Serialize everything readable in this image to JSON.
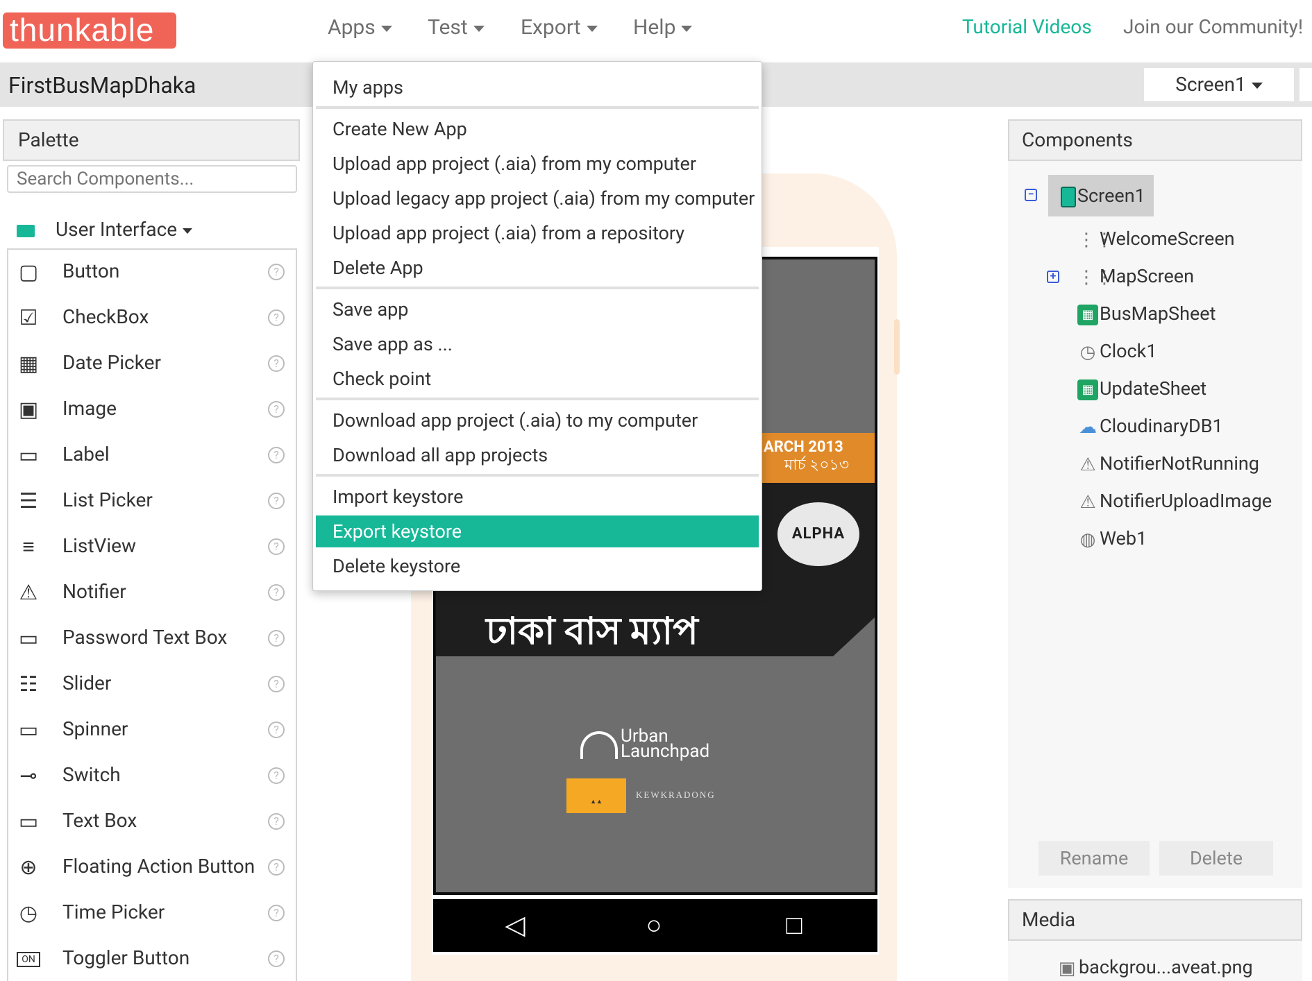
{
  "brand": {
    "logo": "thunkable"
  },
  "nav": {
    "items": [
      "Apps",
      "Test",
      "Export",
      "Help"
    ],
    "tutorial": "Tutorial Videos",
    "community": "Join our Community!"
  },
  "project": {
    "name": "FirstBusMapDhaka",
    "screen": "Screen1"
  },
  "palette": {
    "title": "Palette",
    "search_placeholder": "Search Components...",
    "category": "User Interface",
    "items": [
      {
        "label": "Button",
        "icon": "button-icon"
      },
      {
        "label": "CheckBox",
        "icon": "checkbox-icon"
      },
      {
        "label": "Date Picker",
        "icon": "calendar-icon"
      },
      {
        "label": "Image",
        "icon": "image-icon"
      },
      {
        "label": "Label",
        "icon": "label-icon"
      },
      {
        "label": "List Picker",
        "icon": "list-picker-icon"
      },
      {
        "label": "ListView",
        "icon": "list-icon"
      },
      {
        "label": "Notifier",
        "icon": "warning-icon"
      },
      {
        "label": "Password Text Box",
        "icon": "password-icon"
      },
      {
        "label": "Slider",
        "icon": "slider-icon"
      },
      {
        "label": "Spinner",
        "icon": "spinner-icon"
      },
      {
        "label": "Switch",
        "icon": "switch-icon"
      },
      {
        "label": "Text Box",
        "icon": "textbox-icon"
      },
      {
        "label": "Floating Action Button",
        "icon": "plus-circle-icon"
      },
      {
        "label": "Time Picker",
        "icon": "clock-icon"
      },
      {
        "label": "Toggler Button",
        "icon": "toggle-on-icon"
      }
    ],
    "help_glyph": "?"
  },
  "apps_menu": {
    "items": [
      {
        "label": "My apps"
      },
      {
        "label": "Create New App"
      },
      {
        "label": "Upload app project (.aia) from my computer"
      },
      {
        "label": "Upload legacy app project (.aia) from my computer"
      },
      {
        "label": "Upload app project (.aia) from a repository"
      },
      {
        "label": "Delete App"
      },
      {
        "label": "Save app"
      },
      {
        "label": "Save app as ..."
      },
      {
        "label": "Check point"
      },
      {
        "label": "Download app project (.aia) to my computer"
      },
      {
        "label": "Download all app projects"
      },
      {
        "label": "Import keystore"
      },
      {
        "label": "Export keystore",
        "highlighted": true
      },
      {
        "label": "Delete keystore"
      }
    ]
  },
  "viewer": {
    "march": "ARCH 2013",
    "march_bn": "মার্চ ২০১৩",
    "alpha": "ALPHA",
    "title_bn": "ঢাকা বাস ম্যাপ",
    "urban_1": "Urban",
    "urban_2": "Launchpad",
    "kewkradong": "KEWKRADONG",
    "nav_buttons": [
      "back-icon",
      "home-icon",
      "recents-icon"
    ]
  },
  "components": {
    "title": "Components",
    "root": "Screen1",
    "items": [
      {
        "label": "WelcomeScreen",
        "icon": "arrangement-icon"
      },
      {
        "label": "MapScreen",
        "icon": "arrangement-icon",
        "expandable": true
      },
      {
        "label": "BusMapSheet",
        "icon": "spreadsheet-icon"
      },
      {
        "label": "Clock1",
        "icon": "clock-icon"
      },
      {
        "label": "UpdateSheet",
        "icon": "spreadsheet-icon"
      },
      {
        "label": "CloudinaryDB1",
        "icon": "cloud-icon"
      },
      {
        "label": "NotifierNotRunning",
        "icon": "warning-icon"
      },
      {
        "label": "NotifierUploadImage",
        "icon": "warning-icon"
      },
      {
        "label": "Web1",
        "icon": "globe-icon"
      }
    ],
    "rename": "Rename",
    "delete": "Delete"
  },
  "media": {
    "title": "Media",
    "file": "backgrou...aveat.png"
  },
  "colors": {
    "accent": "#17b898",
    "brand": "#f06458",
    "march": "#e08a2a"
  }
}
